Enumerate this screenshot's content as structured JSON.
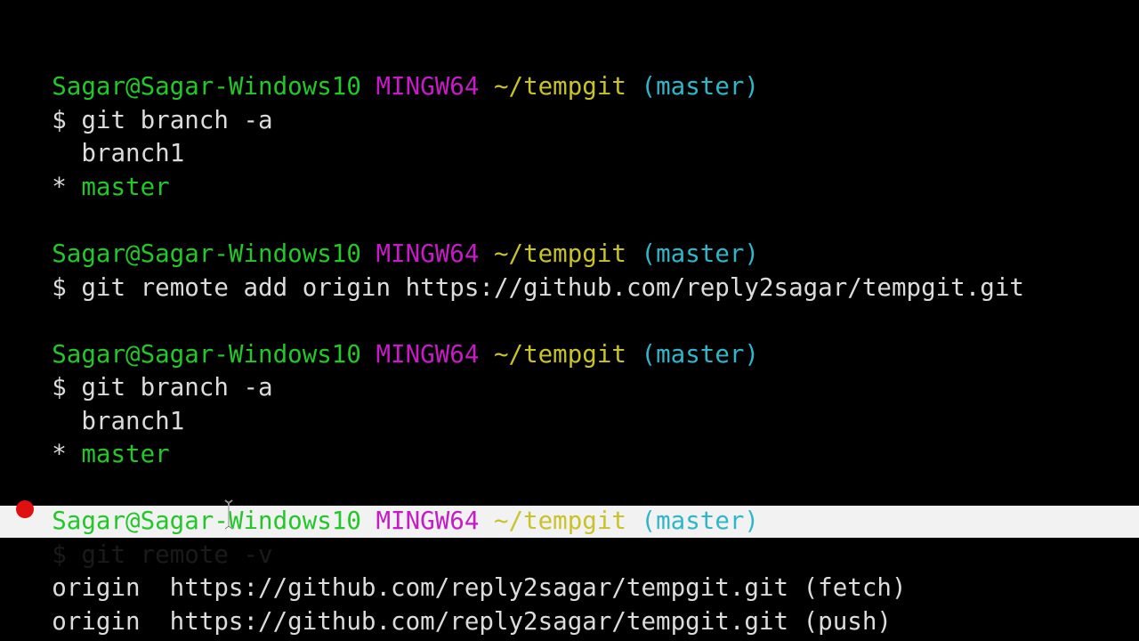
{
  "prompt": {
    "user_host": "Sagar@Sagar-Windows10",
    "system": "MINGW64",
    "path": "~/tempgit",
    "branch": "(master)",
    "symbol": "$"
  },
  "blocks": [
    {
      "command": "git branch -a",
      "output": [
        {
          "marker": " ",
          "text": "branch1",
          "current": false
        },
        {
          "marker": "*",
          "text": "master",
          "current": true
        }
      ]
    },
    {
      "command": "git remote add origin https://github.com/reply2sagar/tempgit.git",
      "output": []
    },
    {
      "command": "git branch -a",
      "output": [
        {
          "marker": " ",
          "text": "branch1",
          "current": false
        },
        {
          "marker": "*",
          "text": "master",
          "current": true
        }
      ]
    },
    {
      "command": "git remote -v",
      "output": [
        {
          "text": "origin  https://github.com/reply2sagar/tempgit.git (fetch)"
        },
        {
          "text": "origin  https://github.com/reply2sagar/tempgit.git (push)"
        }
      ]
    }
  ],
  "colors": {
    "background": "#000000",
    "user_host": "#23c72a",
    "system": "#c51cc5",
    "path": "#c8c32a",
    "branch": "#2fb7c9",
    "text": "#dcdcdc",
    "current_branch": "#23c72a",
    "highlight": "#f2f2f2",
    "pointer": "#e01010"
  }
}
